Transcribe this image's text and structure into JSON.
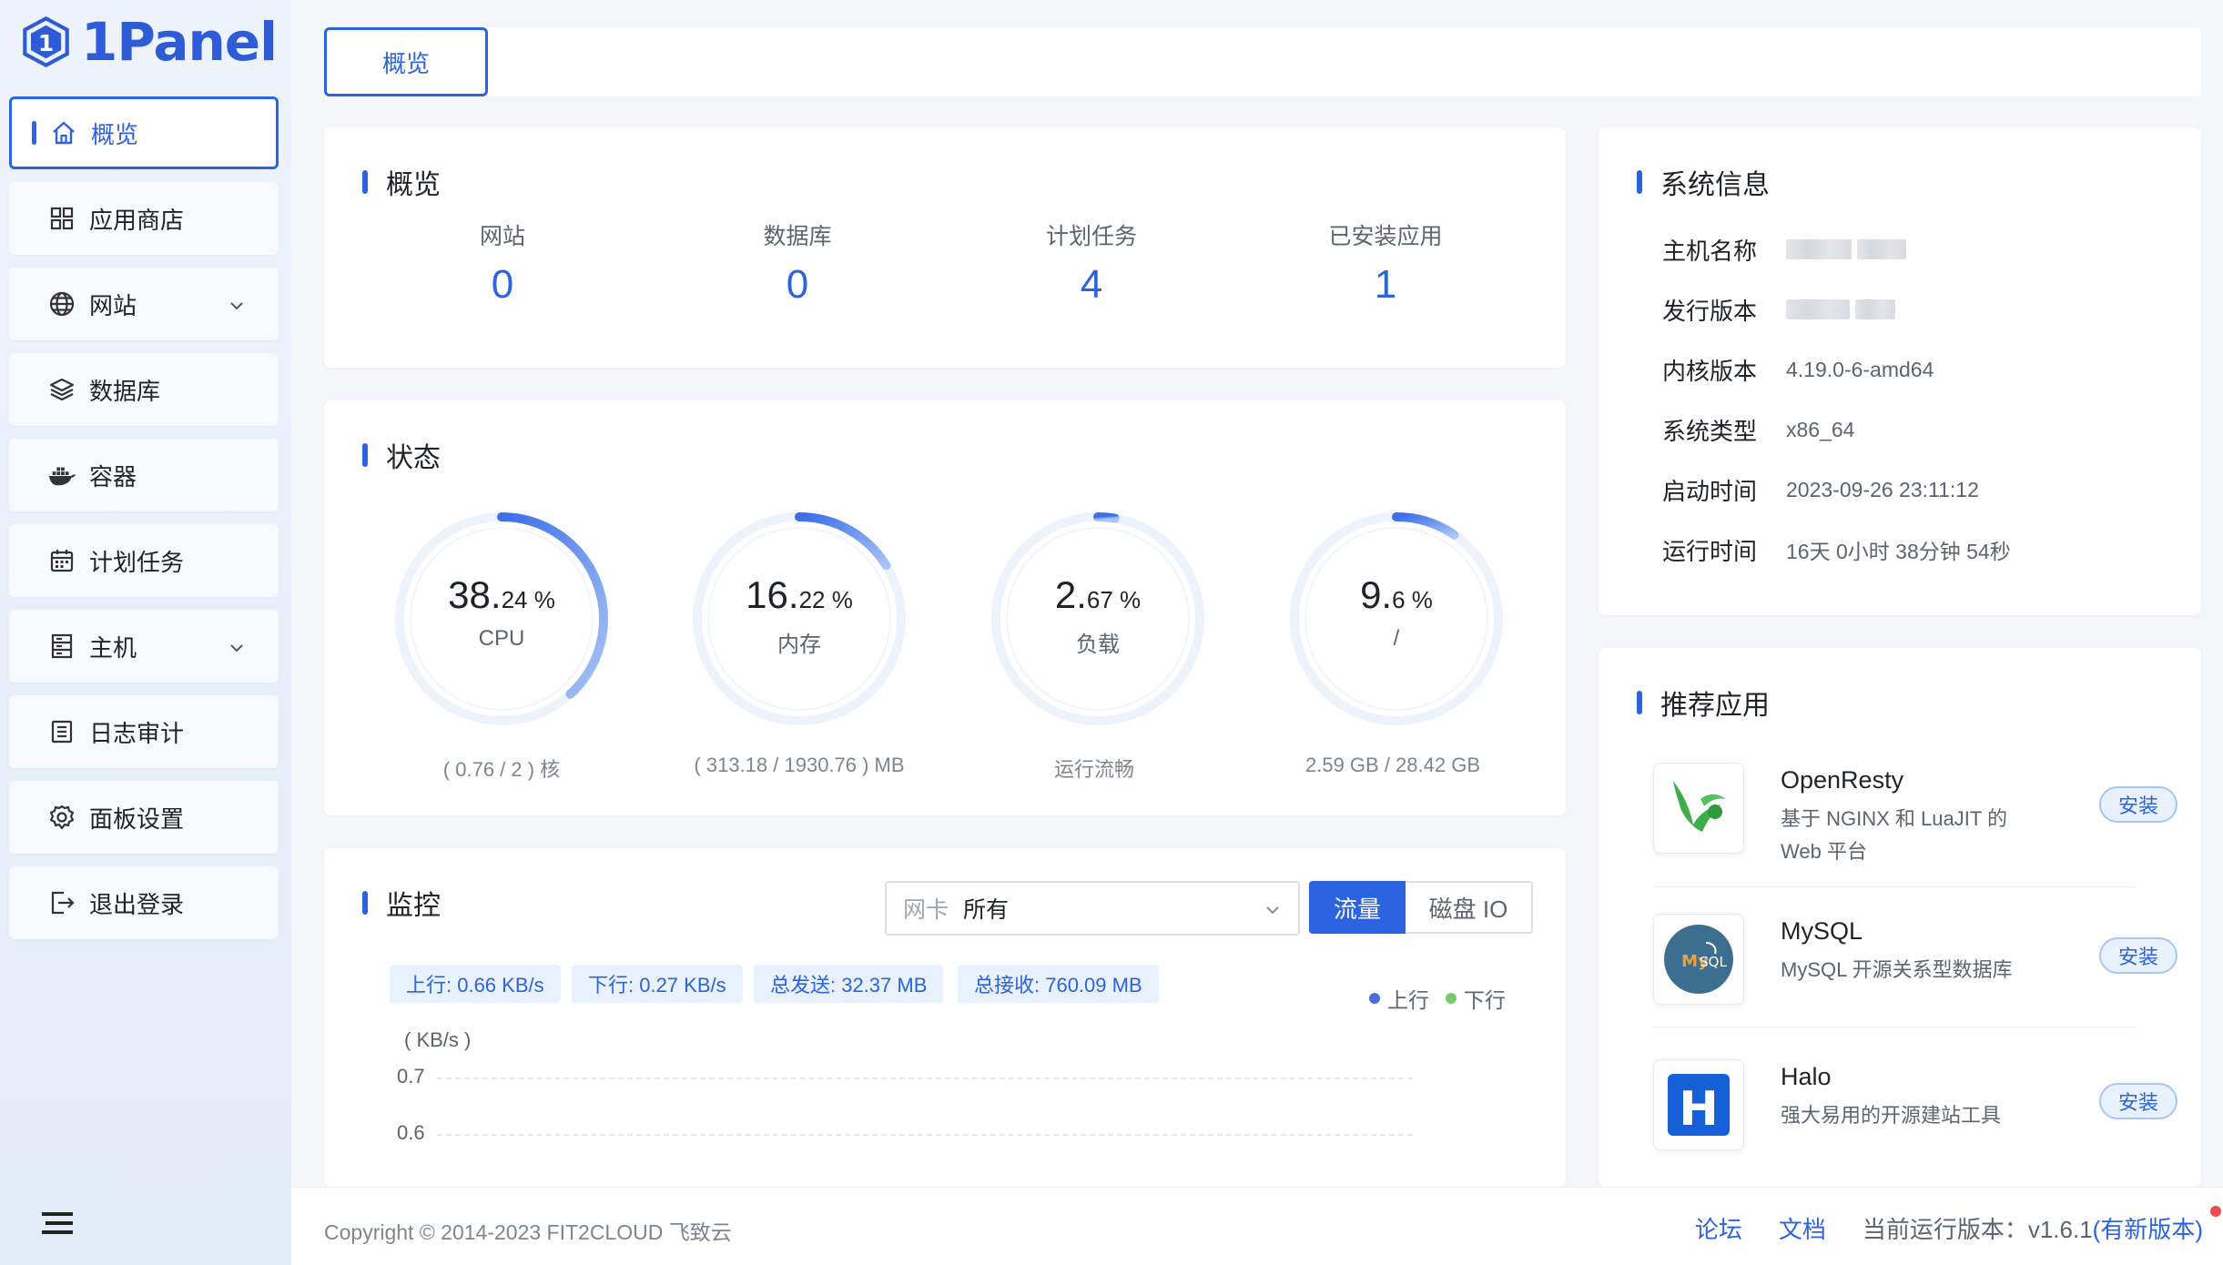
{
  "app": {
    "logo_text": "1Panel",
    "brand_color": "#2b63e0"
  },
  "sidebar": {
    "items": [
      {
        "label": "概览",
        "icon": "home-icon"
      },
      {
        "label": "应用商店",
        "icon": "grid-icon"
      },
      {
        "label": "网站",
        "icon": "globe-icon"
      },
      {
        "label": "数据库",
        "icon": "layers-icon"
      },
      {
        "label": "容器",
        "icon": "docker-icon"
      },
      {
        "label": "计划任务",
        "icon": "calendar-icon"
      },
      {
        "label": "主机",
        "icon": "server-icon"
      },
      {
        "label": "日志审计",
        "icon": "log-icon"
      },
      {
        "label": "面板设置",
        "icon": "gear-icon"
      },
      {
        "label": "退出登录",
        "icon": "logout-icon"
      }
    ]
  },
  "tabs": {
    "overview": "概览"
  },
  "overview": {
    "title": "概览",
    "stats": [
      {
        "label": "网站",
        "value": "0"
      },
      {
        "label": "数据库",
        "value": "0"
      },
      {
        "label": "计划任务",
        "value": "4"
      },
      {
        "label": "已安装应用",
        "value": "1"
      }
    ]
  },
  "status": {
    "title": "状态",
    "gauges": [
      {
        "int": "38.",
        "dec": "24 %",
        "label": "CPU",
        "sub": "( 0.76 / 2 ) 核",
        "percent": 38.24
      },
      {
        "int": "16.",
        "dec": "22 %",
        "label": "内存",
        "sub": "( 313.18 / 1930.76 ) MB",
        "percent": 16.22
      },
      {
        "int": "2.",
        "dec": "67 %",
        "label": "负载",
        "sub": "运行流畅",
        "percent": 2.67
      },
      {
        "int": "9.",
        "dec": "6 %",
        "label": "/",
        "sub": "2.59 GB / 28.42 GB",
        "percent": 9.6
      }
    ]
  },
  "monitor": {
    "title": "监控",
    "nic_label": "网卡",
    "nic_value": "所有",
    "btn_traffic": "流量",
    "btn_disk": "磁盘 IO",
    "chips": [
      "上行: 0.66 KB/s",
      "下行: 0.27 KB/s",
      "总发送: 32.37 MB",
      "总接收: 760.09 MB"
    ],
    "legend": {
      "up": "上行",
      "down": "下行",
      "up_color": "#4a6fd8",
      "down_color": "#7ac96f"
    },
    "unit": "( KB/s )",
    "y_ticks": [
      "0.7",
      "0.6"
    ]
  },
  "system": {
    "title": "系统信息",
    "rows": [
      {
        "k": "主机名称",
        "v": ""
      },
      {
        "k": "发行版本",
        "v": ""
      },
      {
        "k": "内核版本",
        "v": "4.19.0-6-amd64"
      },
      {
        "k": "系统类型",
        "v": "x86_64"
      },
      {
        "k": "启动时间",
        "v": "2023-09-26 23:11:12"
      },
      {
        "k": "运行时间",
        "v": "16天 0小时 38分钟 54秒"
      }
    ]
  },
  "apps": {
    "title": "推荐应用",
    "install_label": "安装",
    "items": [
      {
        "name": "OpenResty",
        "desc": "基于 NGINX 和 LuaJIT 的 Web 平台",
        "icon": "openresty-icon"
      },
      {
        "name": "MySQL",
        "desc": "MySQL 开源关系型数据库",
        "icon": "mysql-icon"
      },
      {
        "name": "Halo",
        "desc": "强大易用的开源建站工具",
        "icon": "halo-icon"
      }
    ]
  },
  "footer": {
    "copyright": "Copyright © 2014-2023 FIT2CLOUD 飞致云",
    "forum": "论坛",
    "docs": "文档",
    "version": "当前运行版本：v1.6.1",
    "new_version": "(有新版本)"
  }
}
